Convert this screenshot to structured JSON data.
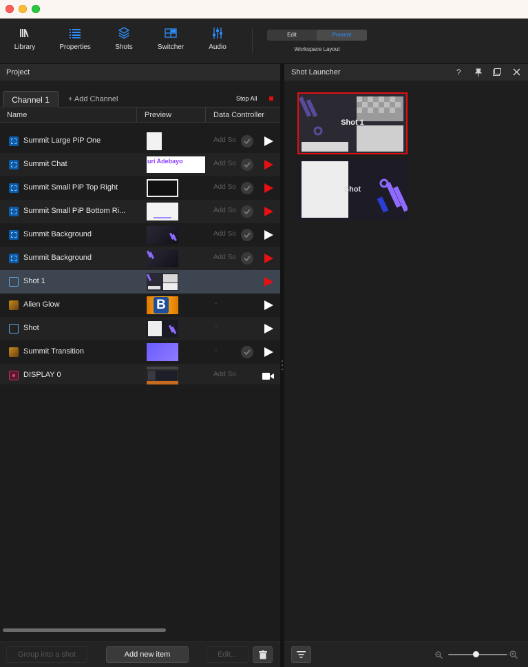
{
  "toolbar": {
    "library": "Library",
    "properties": "Properties",
    "shots": "Shots",
    "switcher": "Switcher",
    "audio": "Audio",
    "workspace_edit": "Edit",
    "workspace_present": "Present",
    "workspace_label": "Workspace Layout"
  },
  "project": {
    "title": "Project",
    "tab": "Channel 1",
    "add_channel": "+ Add Channel",
    "stop_all": "Stop All",
    "columns": {
      "name": "Name",
      "preview": "Preview",
      "data_controller": "Data Controller"
    },
    "rows": [
      {
        "name": "Summit Large PiP One",
        "icon": "title-icon",
        "dc": "Add So",
        "play": "white"
      },
      {
        "name": "Summit Chat",
        "icon": "title-icon",
        "dc": "Add So",
        "play": "red",
        "thumb_text": "uri Adebayo"
      },
      {
        "name": "Summit Small PiP Top Right",
        "icon": "title-icon",
        "dc": "Add So",
        "play": "red"
      },
      {
        "name": "Summit Small PiP Bottom Ri...",
        "icon": "title-icon",
        "dc": "Add So",
        "play": "red"
      },
      {
        "name": "Summit Background",
        "icon": "title-icon",
        "dc": "Add So",
        "play": "white"
      },
      {
        "name": "Summit Background",
        "icon": "title-icon",
        "dc": "Add So",
        "play": "red"
      },
      {
        "name": "Shot 1",
        "icon": "shot-icon",
        "dc": "-",
        "play": "red"
      },
      {
        "name": "Alien Glow",
        "icon": "media-icon",
        "dc": "-",
        "play": "white",
        "thumb_text": "B"
      },
      {
        "name": "Shot",
        "icon": "shot-icon",
        "dc": "-",
        "play": "white"
      },
      {
        "name": "Summit Transition",
        "icon": "media-icon",
        "dc": "-",
        "play": "white"
      },
      {
        "name": "DISPLAY 0",
        "icon": "display-icon",
        "dc": "Add So",
        "play": "camera"
      }
    ],
    "group_button": "Group into a shot",
    "add_item_button": "Add new item",
    "edit_button": "Edit..."
  },
  "launcher": {
    "title": "Shot Launcher",
    "shots": [
      {
        "label": "Shot 1"
      },
      {
        "label": "Shot"
      }
    ]
  },
  "colors": {
    "accent_blue": "#2d8fff",
    "live_red": "#e01010",
    "selected_row": "#3d4550"
  }
}
